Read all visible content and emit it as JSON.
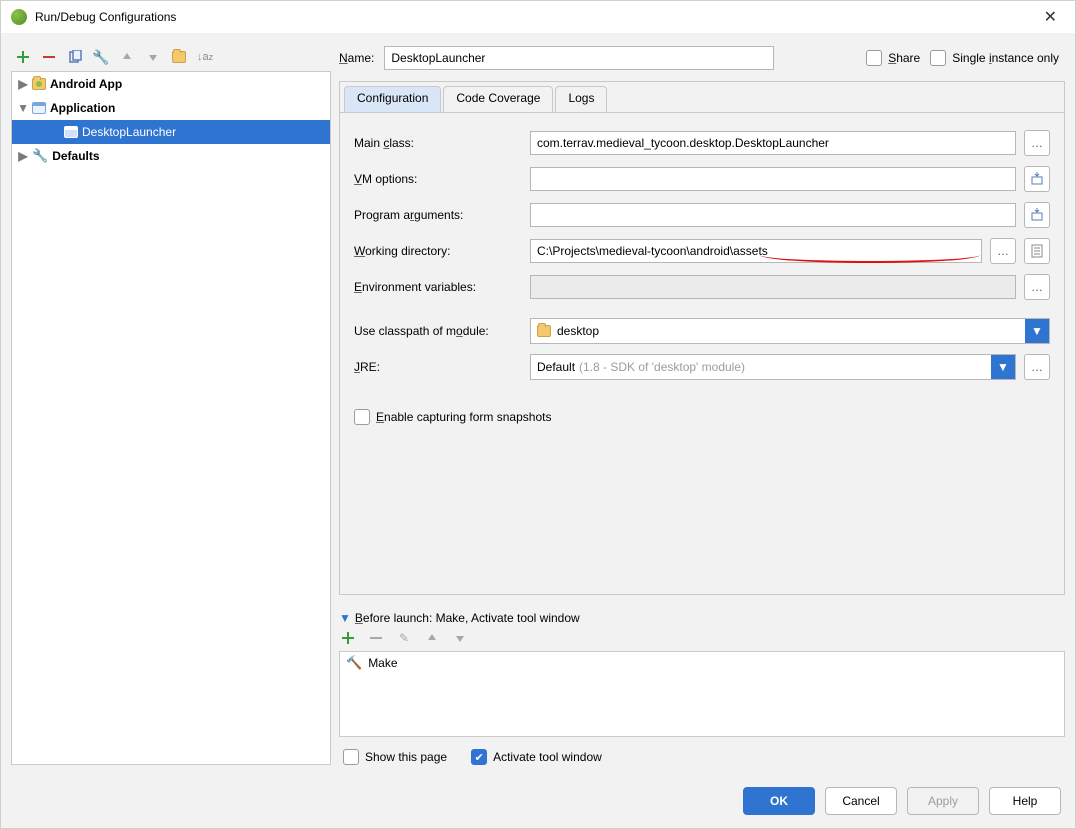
{
  "window": {
    "title": "Run/Debug Configurations"
  },
  "tree": {
    "items": [
      {
        "label": "Android App"
      },
      {
        "label": "Application"
      },
      {
        "label": "DesktopLauncher"
      },
      {
        "label": "Defaults"
      }
    ]
  },
  "header": {
    "name_label": "Name:",
    "name_value": "DesktopLauncher",
    "share_label": "Share",
    "single_instance_label": "Single instance only"
  },
  "tabs": [
    {
      "label": "Configuration"
    },
    {
      "label": "Code Coverage"
    },
    {
      "label": "Logs"
    }
  ],
  "config": {
    "main_class_label": "Main class:",
    "main_class_value": "com.terrav.medieval_tycoon.desktop.DesktopLauncher",
    "vm_options_label": "VM options:",
    "vm_options_value": "",
    "program_args_label": "Program arguments:",
    "program_args_value": "",
    "working_dir_label": "Working directory:",
    "working_dir_value": "C:\\Projects\\medieval-tycoon\\android\\assets",
    "env_vars_label": "Environment variables:",
    "env_vars_value": "",
    "classpath_label": "Use classpath of module:",
    "classpath_value": "desktop",
    "jre_label": "JRE:",
    "jre_value": "Default",
    "jre_hint": "(1.8 - SDK of 'desktop' module)",
    "enable_snapshots_label": "Enable capturing form snapshots"
  },
  "before_launch": {
    "title": "Before launch: Make, Activate tool window",
    "items": [
      {
        "label": "Make"
      }
    ],
    "show_page_label": "Show this page",
    "activate_label": "Activate tool window"
  },
  "footer": {
    "ok": "OK",
    "cancel": "Cancel",
    "apply": "Apply",
    "help": "Help"
  }
}
